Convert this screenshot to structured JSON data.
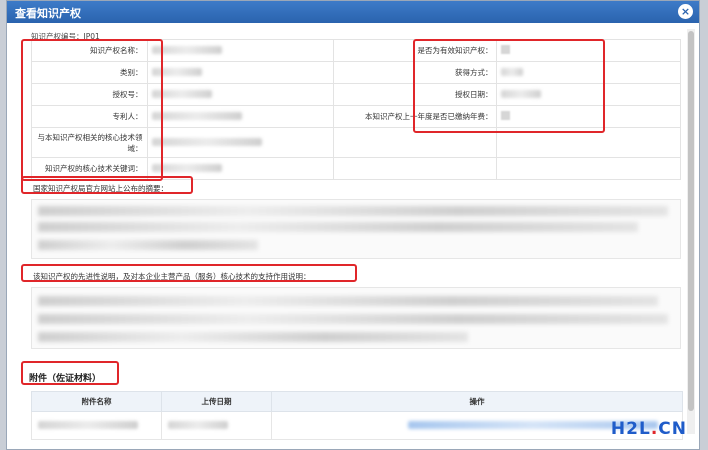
{
  "dialog": {
    "title": "查看知识产权",
    "close_label": "×"
  },
  "ip_number": "知识产权编号：IP01",
  "fields_left": [
    {
      "label": "知识产权名称："
    },
    {
      "label": "类别："
    },
    {
      "label": "授权号："
    },
    {
      "label": "专利人："
    },
    {
      "label": "与本知识产权相关的核心技术领域："
    },
    {
      "label": "知识产权的核心技术关键词："
    }
  ],
  "fields_right": [
    {
      "label": "是否为有效知识产权："
    },
    {
      "label": "获得方式："
    },
    {
      "label": "授权日期："
    },
    {
      "label": "本知识产权上一年度是否已缴纳年费："
    }
  ],
  "sections": {
    "abstract_label": "国家知识产权局官方网站上公布的摘要：",
    "support_label": "该知识产权的先进性说明，及对本企业主营产品（服务）核心技术的支持作用说明："
  },
  "attachments": {
    "title": "附件（佐证材料）",
    "columns": [
      "附件名称",
      "上传日期",
      "操作"
    ]
  },
  "watermark": {
    "part1": "H2L",
    "dot": ".",
    "part2": "CN"
  },
  "colors": {
    "titlebar": "#2a63ae",
    "highlight": "#e0262a",
    "watermark": "#1f5cc9"
  }
}
